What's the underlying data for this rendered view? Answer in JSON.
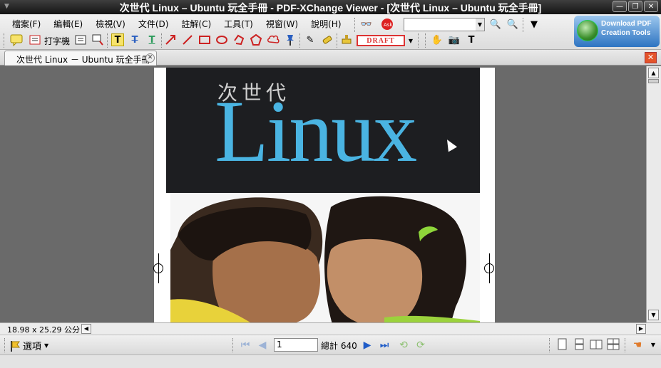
{
  "window": {
    "title": "次世代 Linux – Ubuntu 玩全手冊 - PDF-XChange Viewer - [次世代 Linux – Ubuntu 玩全手冊]"
  },
  "menu": [
    "檔案(F)",
    "編輯(E)",
    "檢視(V)",
    "文件(D)",
    "註解(C)",
    "工具(T)",
    "視窗(W)",
    "說明(H)"
  ],
  "toolbar": {
    "typewriter_label": "打字機",
    "stamp_label": "DRAFT"
  },
  "promo": {
    "line1": "Download PDF",
    "line2": "Creation Tools"
  },
  "tab": {
    "label": "次世代 Linux －  Ubuntu 玩全手冊"
  },
  "document": {
    "cover_subtitle": "次世代",
    "cover_title": "Linux"
  },
  "status": {
    "page_size": "18.98 x 25.29 公分"
  },
  "nav": {
    "options_label": "選項",
    "current_page": "1",
    "total_pages": "總計 640"
  },
  "colors": {
    "accent_blue": "#4ab4e2",
    "close_red": "#e4542a",
    "stamp_red": "#dd3333"
  }
}
